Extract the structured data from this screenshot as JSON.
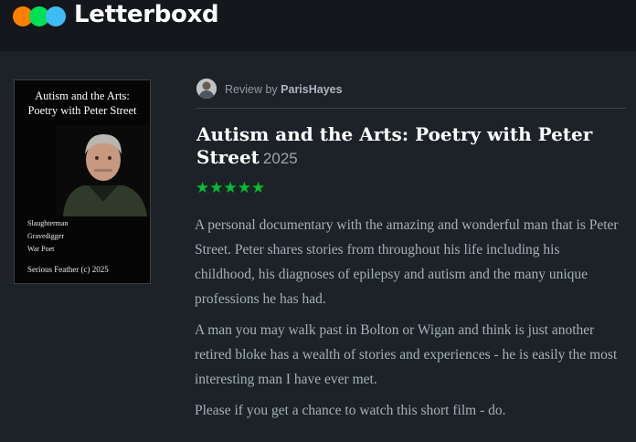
{
  "brand": {
    "name": "Letterboxd",
    "dot_colors": [
      "#ff8000",
      "#00e054",
      "#40bcf4"
    ]
  },
  "poster": {
    "title_line1": "Autism and the Arts:",
    "title_line2": "Poetry with Peter Street",
    "credits": [
      "Slaughterman",
      "Gravedigger",
      "War Poet"
    ],
    "footer": "Serious Feather (c) 2025"
  },
  "review": {
    "prefix": "Review by",
    "username": "ParisHayes",
    "film_title": "Autism and the Arts: Poetry with Peter Street",
    "year": "2025",
    "rating_stars": 5,
    "stars_text": "★★★★★",
    "star_color": "#00c030",
    "paragraphs": [
      "A personal documentary with the amazing and wonderful man that is Peter Street. Peter shares stories from throughout his life including his childhood, his diagnoses of epilepsy and autism and the many unique professions he has had.",
      "A man you may walk past in Bolton or Wigan and think is just another retired bloke has a wealth of stories and experiences - he is easily the most interesting man I have ever met.",
      "Please if you get a chance to watch this short film - do."
    ]
  }
}
